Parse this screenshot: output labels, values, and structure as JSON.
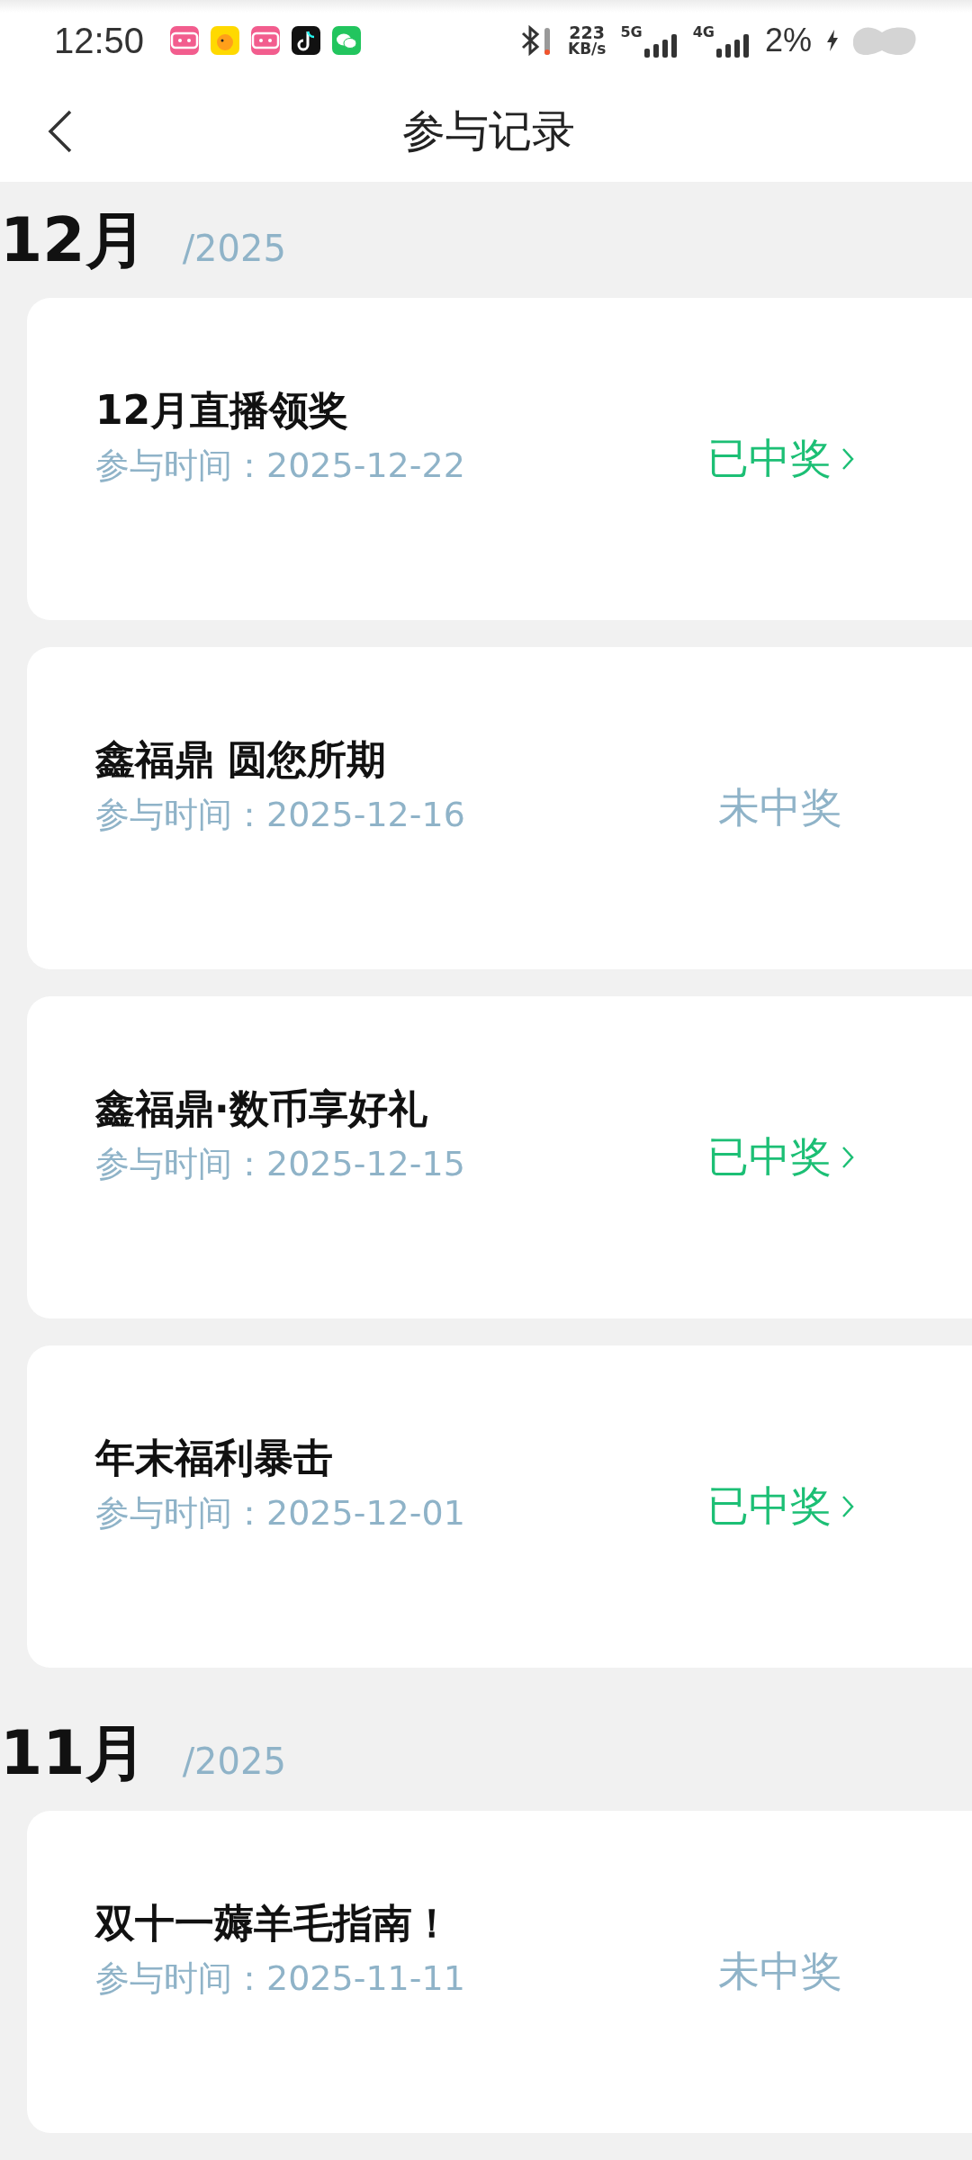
{
  "status_bar": {
    "time": "12:50",
    "apps": [
      {
        "kind": "bili",
        "color": "#f25d8e"
      },
      {
        "kind": "yellow",
        "color": "#ffd900"
      },
      {
        "kind": "bili",
        "color": "#f25d8e"
      },
      {
        "kind": "note",
        "color": "#111111"
      },
      {
        "kind": "chat",
        "color": "#22c55e"
      }
    ],
    "speed": "223",
    "speed_unit": "KB/s",
    "network_1": "5G",
    "network_2": "4G",
    "battery": "2%"
  },
  "header": {
    "title": "参与记录"
  },
  "months": [
    {
      "month": "12月",
      "year": "/2025",
      "records": [
        {
          "title": "12月直播领奖",
          "date": "参与时间：2025-12-22",
          "status": "已中奖",
          "won": true
        },
        {
          "title": "鑫福鼎 圆您所期",
          "date": "参与时间：2025-12-16",
          "status": "未中奖",
          "won": false
        },
        {
          "title": "鑫福鼎·数币享好礼",
          "date": "参与时间：2025-12-15",
          "status": "已中奖",
          "won": true
        },
        {
          "title": "年末福利暴击",
          "date": "参与时间：2025-12-01",
          "status": "已中奖",
          "won": true
        }
      ]
    },
    {
      "month": "11月",
      "year": "/2025",
      "records": [
        {
          "title": "双十一薅羊毛指南！",
          "date": "参与时间：2025-11-11",
          "status": "未中奖",
          "won": false
        }
      ]
    }
  ]
}
